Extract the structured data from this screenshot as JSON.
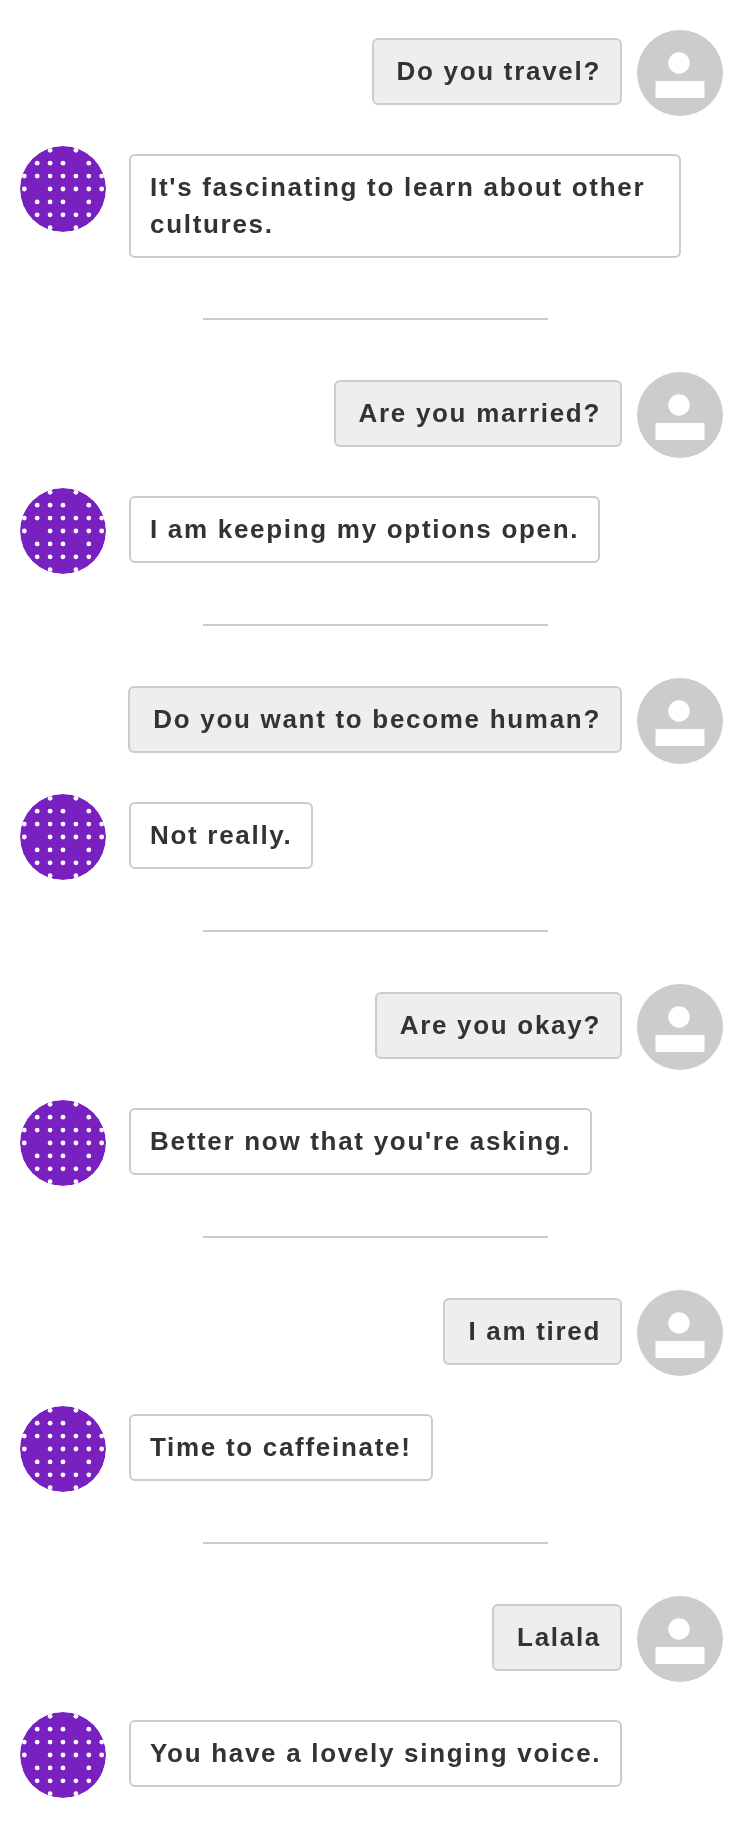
{
  "conversation": [
    {
      "user": "Do you travel?",
      "bot": "It's fascinating to learn about other cultures."
    },
    {
      "user": "Are you married?",
      "bot": "I am keeping my options open."
    },
    {
      "user": "Do you want to become human?",
      "bot": "Not really."
    },
    {
      "user": "Are you okay?",
      "bot": "Better now that you're asking."
    },
    {
      "user": "I am tired",
      "bot": "Time to caffeinate!"
    },
    {
      "user": "Lalala",
      "bot": "You have a lovely singing voice."
    }
  ]
}
